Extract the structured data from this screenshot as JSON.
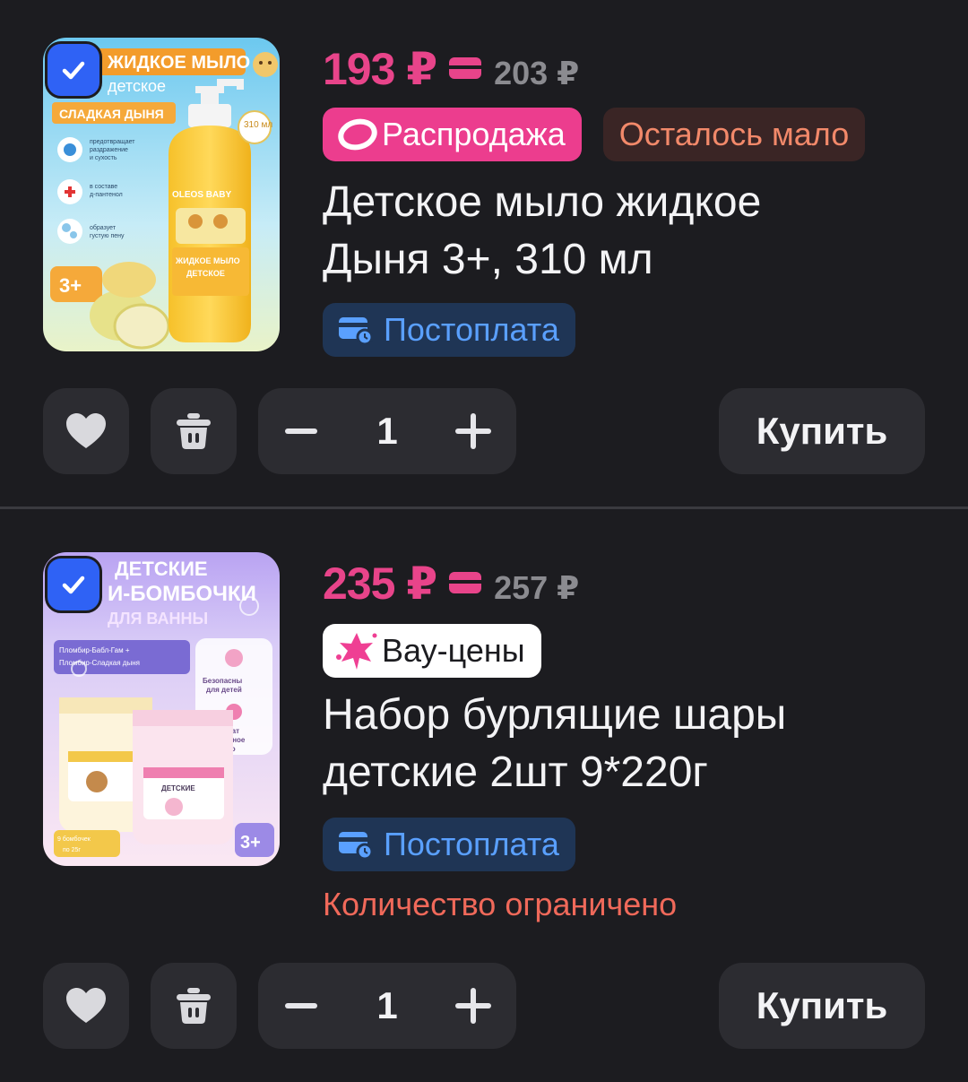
{
  "colors": {
    "background": "#1c1c20",
    "price": "#e8448a",
    "checkbox": "#2f62f5",
    "sale_badge": "#ec3d8e",
    "low_stock_text": "#f2896a",
    "postpay_text": "#5aa0ff",
    "limited_text": "#f0695a",
    "button_bg": "#2c2c31"
  },
  "items": [
    {
      "price": "193 ₽",
      "old_price": "203 ₽",
      "badges": [
        "Распродажа",
        "Осталось мало"
      ],
      "title_line1": "Детское мыло жидкое",
      "title_line2": "Дыня 3+, 310 мл",
      "postpay": "Постоплата",
      "image": {
        "header": "ЖИДКОЕ МЫЛО",
        "subheader": "детское",
        "flavor": "СЛАДКАЯ ДЫНЯ",
        "benefits": [
          "предотвращает раздражение и сухость",
          "в составе д-пантенол",
          "образует густую пену"
        ],
        "volume": "310 мл",
        "age": "3+",
        "brand": "OLEOS BABY"
      },
      "quantity": "1",
      "buy_label": "Купить",
      "checked": true
    },
    {
      "price": "235 ₽",
      "old_price": "257 ₽",
      "badges": [
        "Вау-цены"
      ],
      "title_line1": "Набор бурлящие шары",
      "title_line2": "детские 2шт 9*220г",
      "postpay": "Постоплата",
      "limited": "Количество ограничено",
      "image": {
        "header_line1": "ДЕТСКИЕ",
        "header_line2": "И-БОМБОЧКИ",
        "header_line3": "ДЛЯ ВАННЫ",
        "flavors": "Пломбир-Бабл-Гам + Пломбир-Сладкая дыня",
        "safe": "Безопасны для детей",
        "oil": "Содержат миндальное масло",
        "count": "9 бомбочек по 25г",
        "age": "3+"
      },
      "quantity": "1",
      "buy_label": "Купить",
      "checked": true
    }
  ]
}
